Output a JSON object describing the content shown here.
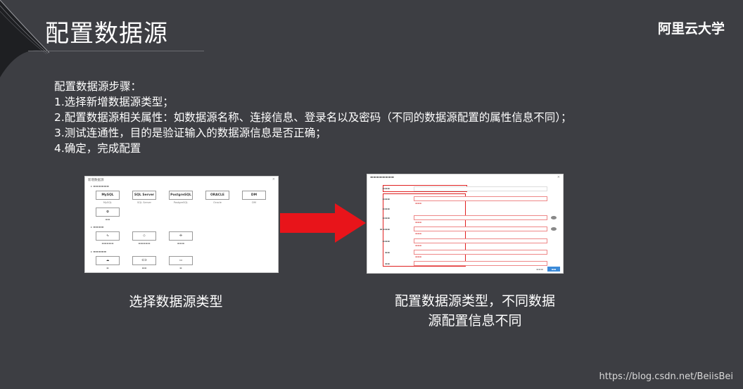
{
  "slide": {
    "title": "配置数据源",
    "brand": "阿里云大学",
    "steps_heading": "配置数据源步骤：",
    "steps": [
      "1.选择新增数据源类型；",
      "2.配置数据源相关属性：如数据源名称、连接信息、登录名以及密码（不同的数据源配置的属性信息不同）；",
      "3.测试连通性，目的是验证输入的数据源信息是否正确；",
      "4.确定，完成配置"
    ],
    "caption_left": "选择数据源类型",
    "caption_right_line1": "配置数据源类型，不同数据",
    "caption_right_line2": "源配置信息不同",
    "watermark": "https://blog.csdn.net/BeiisBei"
  },
  "left_shot": {
    "header": "新增数据源",
    "tiles": [
      {
        "name": "MySQL",
        "label": "MySQL"
      },
      {
        "name": "SQL Server",
        "label": "SQL Server"
      },
      {
        "name": "PostgreSQL",
        "label": "PostgreSQL"
      },
      {
        "name": "ORACLE",
        "label": "Oracle"
      },
      {
        "name": "DM",
        "label": "DM"
      }
    ]
  },
  "colors": {
    "background": "#3d3e43",
    "arrow": "#e8141a",
    "highlight": "#e02020"
  }
}
